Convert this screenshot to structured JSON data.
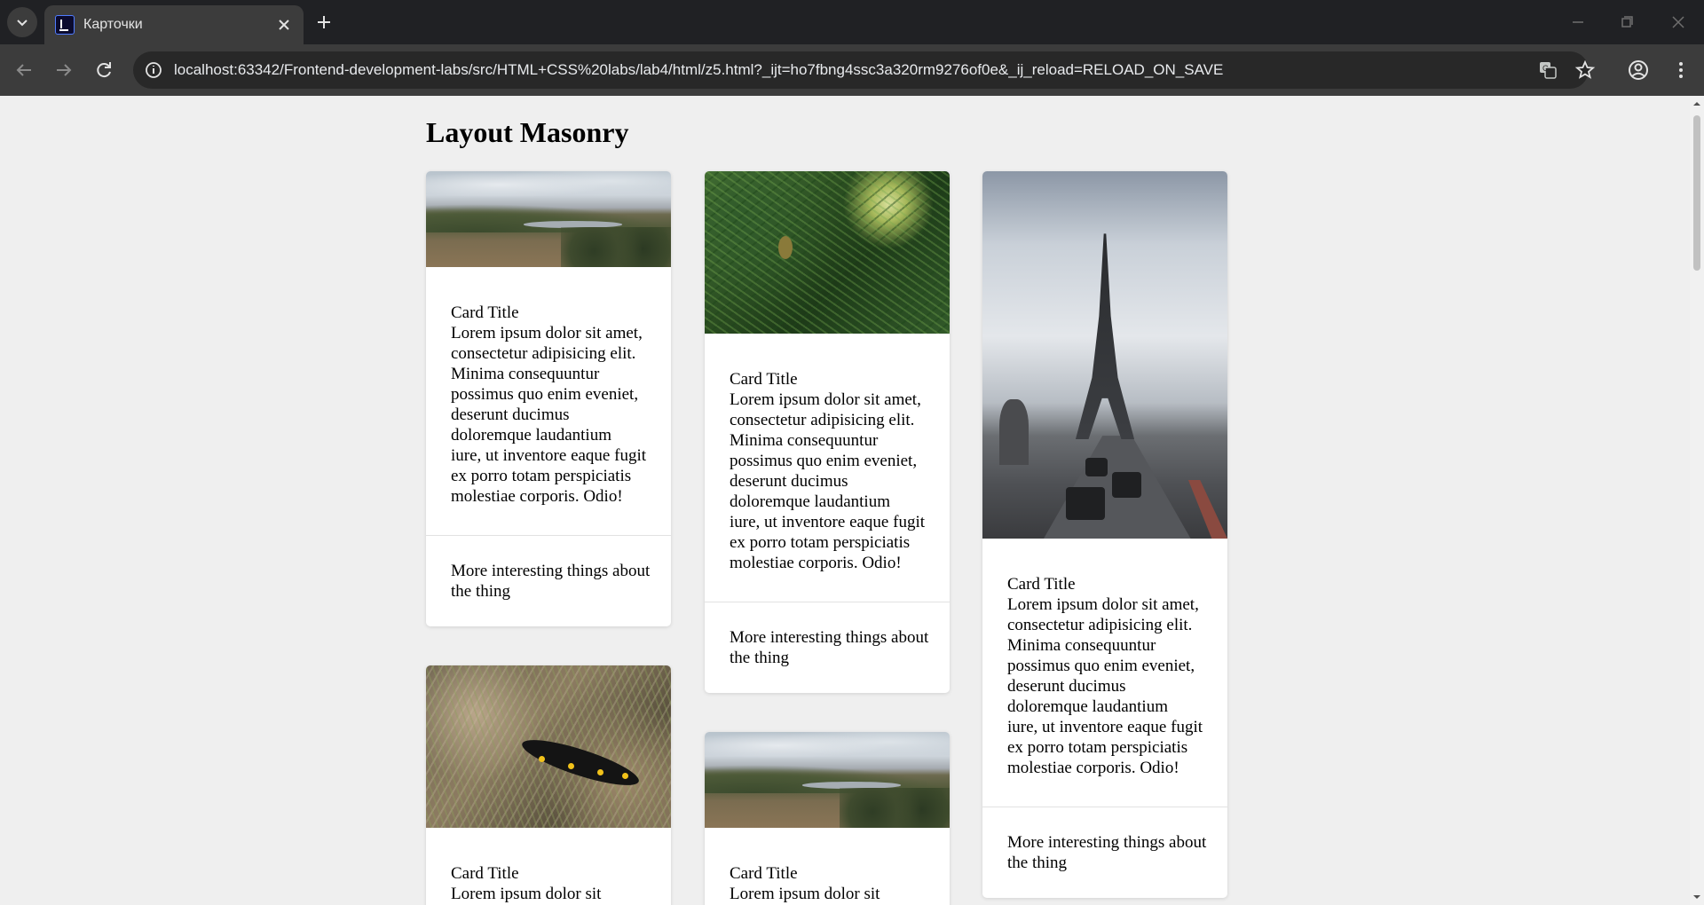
{
  "browser": {
    "tab_title": "Карточки",
    "url": "localhost:63342/Frontend-development-labs/src/HTML+CSS%20labs/lab4/html/z5.html?_ijt=ho7fbng4ssc3a320rm9276of0e&_ij_reload=RELOAD_ON_SAVE"
  },
  "page": {
    "title": "Layout Masonry",
    "cards": [
      {
        "image": "landscape-hills-lake",
        "title": "Card Title",
        "text": "Lorem ipsum dolor sit amet, consectetur adipisicing elit. Minima consequuntur possimus quo enim eveniet, deserunt ducimus doloremque laudantium iure, ut inventore eaque fugit ex porro totam perspiciatis molestiae corporis. Odio!",
        "footer": "More interesting things about the thing"
      },
      {
        "image": "pine-branch",
        "title": "Card Title",
        "text": "Lorem ipsum dolor sit amet, consectetur adipisicing elit. Minima consequuntur possimus quo enim eveniet, deserunt ducimus doloremque laudantium iure, ut inventore eaque fugit ex porro totam perspiciatis molestiae corporis. Odio!",
        "footer": "More interesting things about the thing"
      },
      {
        "image": "eiffel-tower-street",
        "title": "Card Title",
        "text": "Lorem ipsum dolor sit amet, consectetur adipisicing elit. Minima consequuntur possimus quo enim eveniet, deserunt ducimus doloremque laudantium iure, ut inventore eaque fugit ex porro totam perspiciatis molestiae corporis. Odio!",
        "footer": "More interesting things about the thing"
      },
      {
        "image": "salamander-grass",
        "title": "Card Title",
        "text": "Lorem ipsum dolor sit"
      },
      {
        "image": "landscape-hills-lake",
        "title": "Card Title",
        "text": "Lorem ipsum dolor sit"
      }
    ]
  },
  "colors": {
    "page_background": "#efefef",
    "card_background": "#ffffff",
    "chrome_dark": "#202124",
    "chrome_toolbar": "#3c3c3c"
  }
}
